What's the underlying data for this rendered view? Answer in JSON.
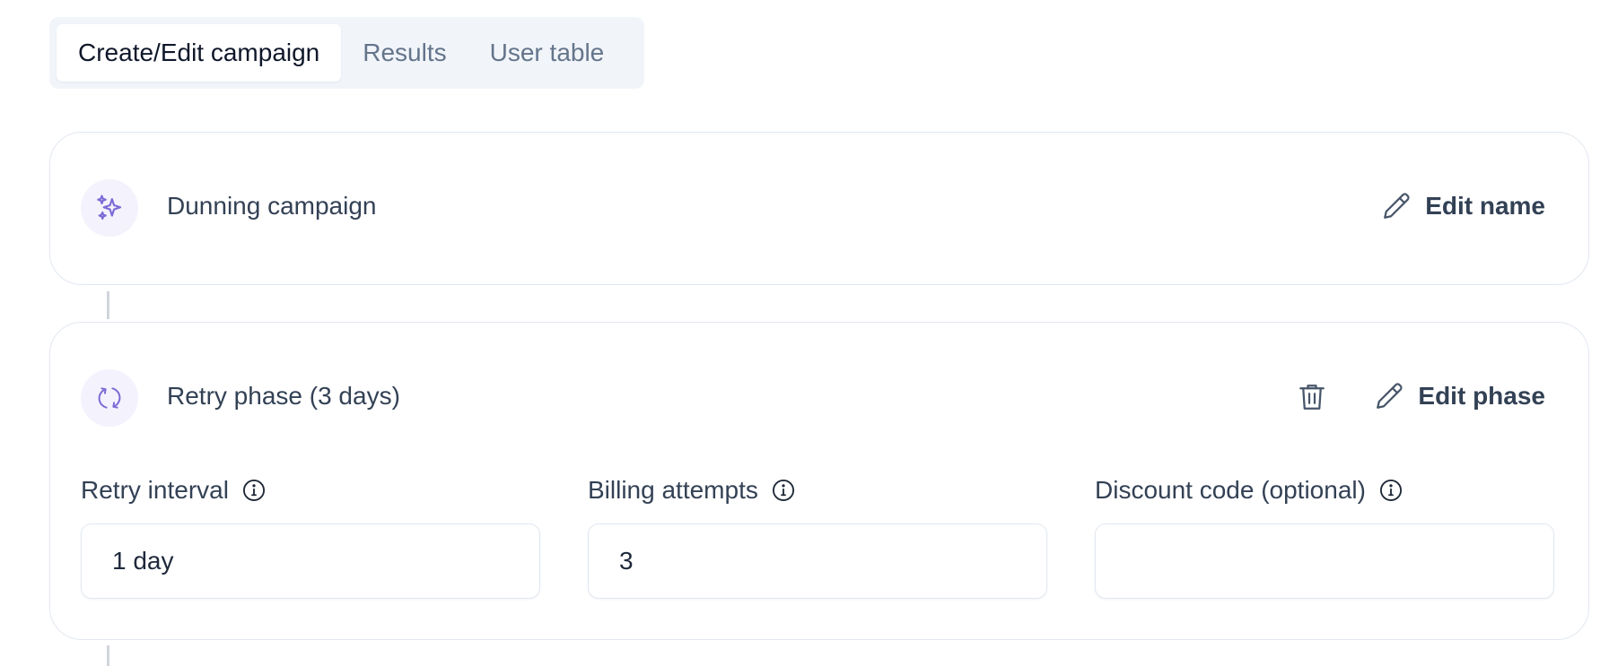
{
  "tabs": [
    {
      "label": "Create/Edit campaign",
      "active": true
    },
    {
      "label": "Results",
      "active": false
    },
    {
      "label": "User table",
      "active": false
    }
  ],
  "campaign": {
    "title": "Dunning campaign",
    "icon": "sparkles-icon",
    "edit_label": "Edit name"
  },
  "phase": {
    "title": "Retry phase (3 days)",
    "icon": "refresh-icon",
    "edit_label": "Edit phase",
    "fields": [
      {
        "label": "Retry interval",
        "value": "1 day",
        "placeholder": ""
      },
      {
        "label": "Billing attempts",
        "value": "3",
        "placeholder": ""
      },
      {
        "label": "Discount code (optional)",
        "value": "",
        "placeholder": ""
      }
    ]
  },
  "colors": {
    "accent": "#7c6bd6",
    "icon_bg": "#f4f2fd",
    "border": "#e2e8f0",
    "tab_bg": "#f1f5fa"
  }
}
